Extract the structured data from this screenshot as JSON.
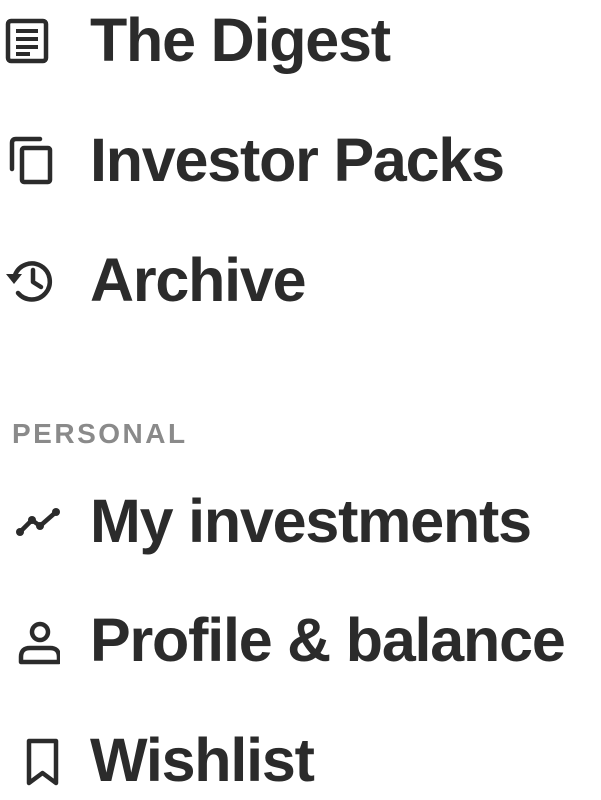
{
  "nav": {
    "main_items": [
      {
        "label": "The Digest",
        "icon": "article-icon"
      },
      {
        "label": "Investor Packs",
        "icon": "copy-icon"
      },
      {
        "label": "Archive",
        "icon": "history-icon"
      }
    ],
    "personal_heading": "PERSONAL",
    "personal_items": [
      {
        "label": "My investments",
        "icon": "trend-line-icon"
      },
      {
        "label": "Profile & balance",
        "icon": "user-icon"
      },
      {
        "label": "Wishlist",
        "icon": "bookmark-icon"
      }
    ]
  }
}
